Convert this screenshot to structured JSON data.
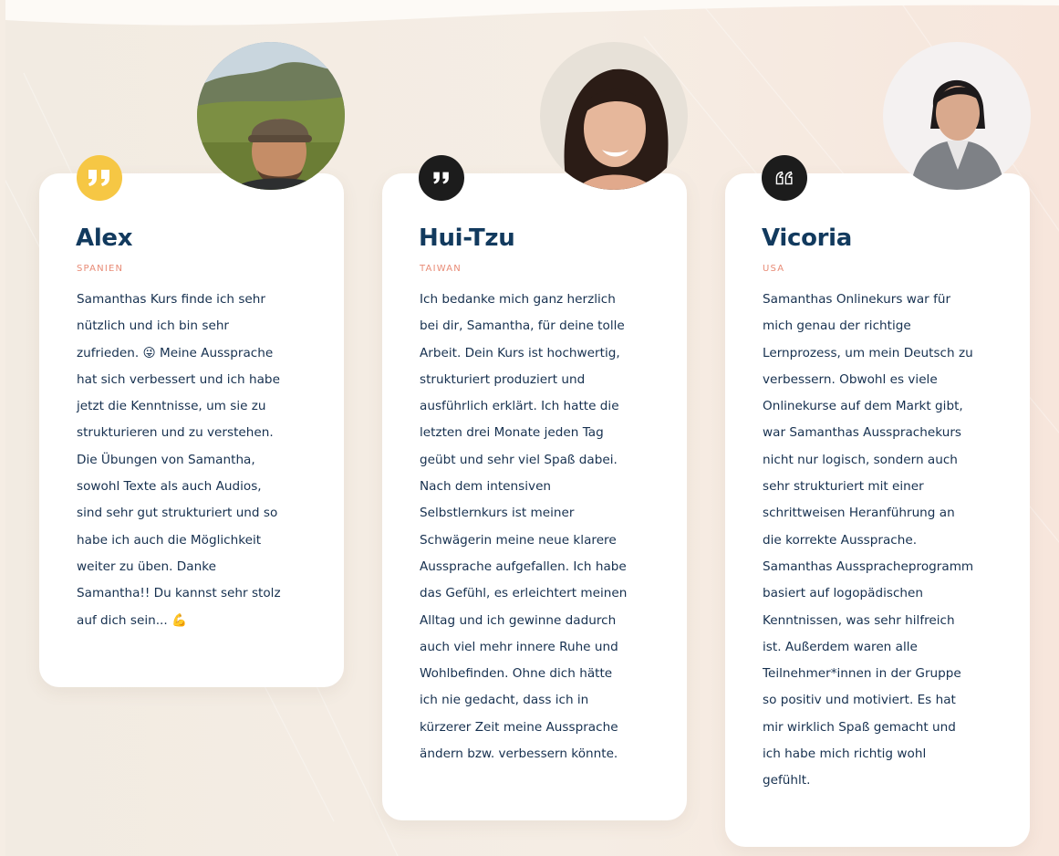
{
  "testimonials": [
    {
      "name": "Alex",
      "country": "SPANIEN",
      "quote_icon": "quote-icon",
      "quote_color": "#f6c744",
      "avatar": "avatar-photo-man-with-cap",
      "lines": [
        "Samanthas Kurs finde ich sehr",
        "nützlich und ich bin sehr",
        "zufrieden. 😜 Meine Aussprache",
        "hat sich verbessert und ich habe",
        "jetzt die Kenntnisse, um sie zu",
        "strukturieren und zu verstehen.",
        "Die Übungen von Samantha,",
        "sowohl Texte als auch Audios,",
        "sind sehr gut strukturiert und so",
        "habe ich auch die Möglichkeit",
        "weiter zu üben. Danke",
        "Samantha!! Du kannst sehr stolz",
        "auf dich sein... 💪"
      ]
    },
    {
      "name": "Hui-Tzu",
      "country": "TAIWAN",
      "quote_icon": "quote-icon",
      "quote_color": "#1c1c1c",
      "avatar": "avatar-photo-smiling-woman",
      "lines": [
        "Ich bedanke mich ganz herzlich",
        "bei dir, Samantha, für deine tolle",
        "Arbeit. Dein Kurs ist hochwertig,",
        "strukturiert produziert und",
        "ausführlich erklärt. Ich hatte die",
        "letzten drei Monate jeden Tag",
        "geübt und sehr viel Spaß dabei.",
        "Nach dem intensiven",
        "Selbstlernkurs ist meiner",
        "Schwägerin meine neue klarere",
        "Aussprache aufgefallen. Ich habe",
        "das Gefühl, es erleichtert meinen",
        "Alltag und ich gewinne dadurch",
        "auch viel mehr innere Ruhe und",
        "Wohlbefinden. Ohne dich hätte",
        "ich nie gedacht, dass ich in",
        "kürzerer Zeit meine Aussprache",
        "ändern bzw. verbessern könnte."
      ]
    },
    {
      "name": "Vicoria",
      "country": "USA",
      "quote_icon": "quote-open-icon",
      "quote_color": "#1c1c1c",
      "avatar": "avatar-photo-woman-in-blazer",
      "lines": [
        "Samanthas Onlinekurs war für",
        "mich genau der richtige",
        "Lernprozess, um mein Deutsch zu",
        "verbessern. Obwohl es viele",
        "Onlinekurse auf dem Markt gibt,",
        "war Samanthas Aussprachekurs",
        "nicht nur logisch, sondern auch",
        "sehr strukturiert mit einer",
        "schrittweisen Heranführung an",
        "die korrekte Aussprache.",
        "Samanthas Ausspracheprogramm",
        "basiert auf logopädischen",
        "Kenntnissen, was sehr hilfreich",
        "ist. Außerdem waren alle",
        "Teilnehmer*innen in der Gruppe",
        "so positiv und motiviert. Es hat",
        "mir wirklich Spaß gemacht und",
        "ich habe mich richtig wohl",
        "gefühlt."
      ]
    }
  ],
  "colors": {
    "background": "#f5ede4",
    "card": "#ffffff",
    "name": "#123a5e",
    "country": "#e88b76",
    "text": "#16304f"
  }
}
